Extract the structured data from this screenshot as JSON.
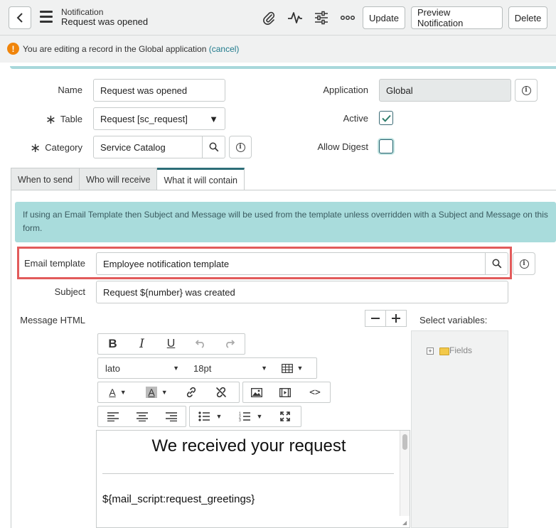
{
  "header": {
    "record_type": "Notification",
    "record_name": "Request was opened",
    "buttons": {
      "update": "Update",
      "preview": "Preview Notification",
      "delete": "Delete"
    },
    "icons": [
      "paperclip-icon",
      "activity-icon",
      "sliders-icon",
      "more-icon"
    ]
  },
  "notice": {
    "text": "You are editing a record in the Global application",
    "link": "(cancel)"
  },
  "form": {
    "name_label": "Name",
    "name_value": "Request was opened",
    "table_label": "Table",
    "table_value": "Request [sc_request]",
    "category_label": "Category",
    "category_value": "Service Catalog",
    "application_label": "Application",
    "application_value": "Global",
    "active_label": "Active",
    "active_checked": true,
    "allow_digest_label": "Allow Digest",
    "allow_digest_checked": false
  },
  "tabs": [
    {
      "label": "When to send",
      "active": false
    },
    {
      "label": "Who will receive",
      "active": false
    },
    {
      "label": "What it will contain",
      "active": true
    }
  ],
  "content": {
    "info_banner": "If using an Email Template then Subject and Message will be used from the template unless overridden with a Subject and Message on this form.",
    "email_template_label": "Email template",
    "email_template_value": "Employee notification template",
    "subject_label": "Subject",
    "subject_value": "Request ${number} was created",
    "message_label": "Message HTML",
    "select_variables_label": "Select variables:",
    "tree_root": "Fields"
  },
  "editor": {
    "font_family": "lato",
    "font_size": "18pt",
    "heading": "We received your request",
    "script_line": "${mail_script:request_greetings}"
  },
  "colors": {
    "accent": "#2d6e78",
    "banner": "#a9dcdc",
    "highlight": "#e25b5b",
    "warning": "#f0850b"
  }
}
